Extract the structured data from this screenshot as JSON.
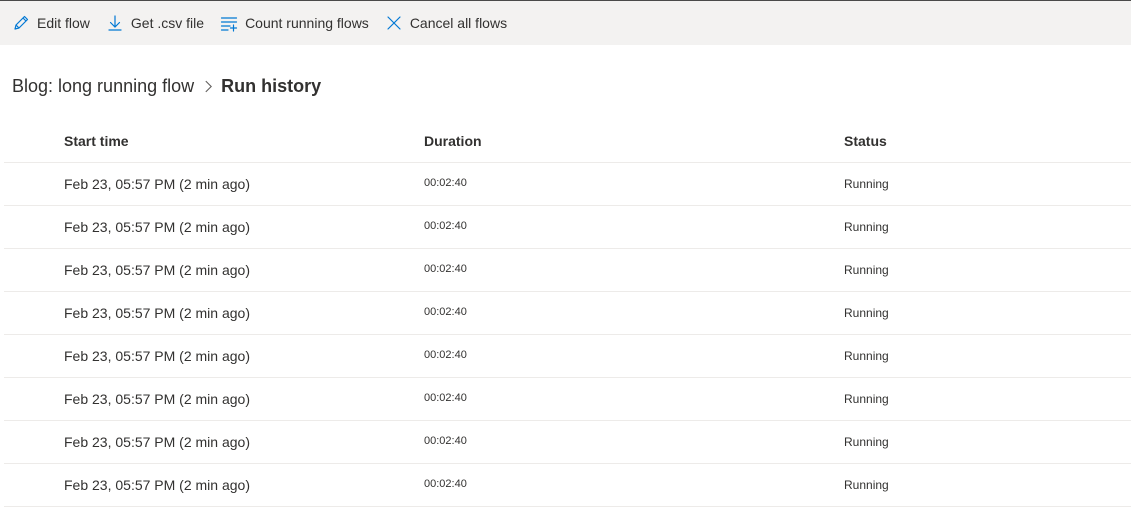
{
  "commands": [
    {
      "label": "Edit flow",
      "icon": "pencil-icon"
    },
    {
      "label": "Get .csv file",
      "icon": "download-icon"
    },
    {
      "label": "Count running flows",
      "icon": "list-count-icon"
    },
    {
      "label": "Cancel all flows",
      "icon": "close-icon"
    }
  ],
  "breadcrumb": {
    "parent": "Blog: long running flow",
    "current": "Run history"
  },
  "table": {
    "headers": {
      "start": "Start time",
      "duration": "Duration",
      "status": "Status"
    },
    "rows": [
      {
        "start": "Feb 23, 05:57 PM (2 min ago)",
        "duration": "00:02:40",
        "status": "Running"
      },
      {
        "start": "Feb 23, 05:57 PM (2 min ago)",
        "duration": "00:02:40",
        "status": "Running"
      },
      {
        "start": "Feb 23, 05:57 PM (2 min ago)",
        "duration": "00:02:40",
        "status": "Running"
      },
      {
        "start": "Feb 23, 05:57 PM (2 min ago)",
        "duration": "00:02:40",
        "status": "Running"
      },
      {
        "start": "Feb 23, 05:57 PM (2 min ago)",
        "duration": "00:02:40",
        "status": "Running"
      },
      {
        "start": "Feb 23, 05:57 PM (2 min ago)",
        "duration": "00:02:40",
        "status": "Running"
      },
      {
        "start": "Feb 23, 05:57 PM (2 min ago)",
        "duration": "00:02:40",
        "status": "Running"
      },
      {
        "start": "Feb 23, 05:57 PM (2 min ago)",
        "duration": "00:02:40",
        "status": "Running"
      }
    ]
  },
  "colors": {
    "accent": "#0078d4",
    "cmdbar": "#f3f2f1",
    "text": "#323130",
    "divider": "#edebe9"
  }
}
